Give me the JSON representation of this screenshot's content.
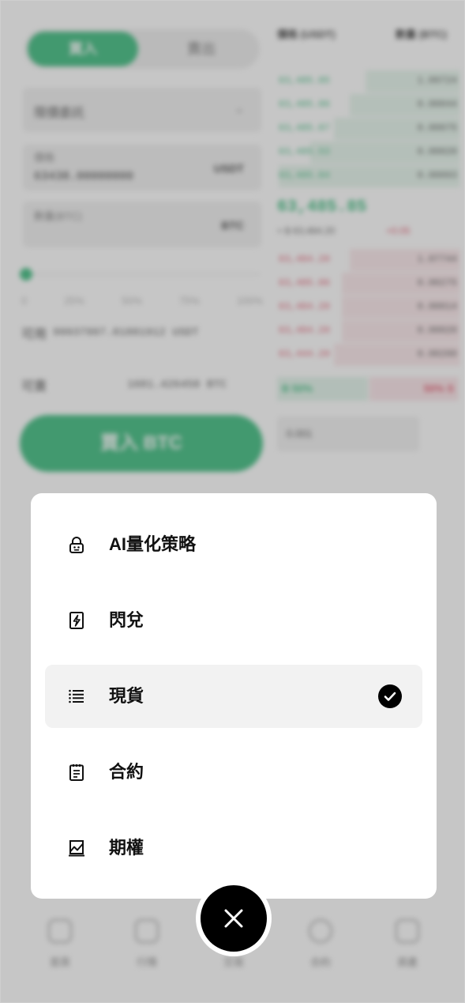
{
  "menu": {
    "items": [
      {
        "label": "AI量化策略",
        "icon": "robot-lock-icon",
        "selected": false
      },
      {
        "label": "閃兌",
        "icon": "flash-icon",
        "selected": false
      },
      {
        "label": "現貨",
        "icon": "list-icon",
        "selected": true
      },
      {
        "label": "合約",
        "icon": "contract-icon",
        "selected": false
      },
      {
        "label": "期權",
        "icon": "chart-icon",
        "selected": false
      }
    ],
    "close_icon": "close-icon",
    "check_icon": "check-circle-icon"
  },
  "background": {
    "buy_tab": "買入",
    "sell_tab": "賣出",
    "order_type": "限價委託",
    "price_label": "價格",
    "price_value": "63438.00000000",
    "price_unit": "USDT",
    "amount_label": "數量(BTC)",
    "amount_unit": "BTC",
    "percents": [
      "0",
      "25%",
      "50%",
      "75%",
      "100%"
    ],
    "available_label": "可用",
    "available_usdt": "99937997.81881912 USDT",
    "available_label_2": "可賣",
    "available_btc": "1681.426458 BTC",
    "buy_button": "買入 BTC",
    "book_head_price": "價格 (USDT)",
    "book_head_qty": "數量 (BTC)",
    "bids": [
      {
        "price": "63,485.85",
        "qty": "1.09724"
      },
      {
        "price": "63,485.86",
        "qty": "0.00044"
      },
      {
        "price": "63,485.87",
        "qty": "0.00075"
      },
      {
        "price": "63,485.53",
        "qty": "0.00020"
      },
      {
        "price": "63,485.84",
        "qty": "0.00093"
      }
    ],
    "mid_price": "63,485.85",
    "mid_sub": "≈ $ 63,484.20",
    "mid_change": "+0.05",
    "asks": [
      {
        "price": "63,484.20",
        "qty": "1.07744"
      },
      {
        "price": "63,485.86",
        "qty": "0.00275"
      },
      {
        "price": "63,484.20",
        "qty": "0.00014"
      },
      {
        "price": "63,484.20",
        "qty": "0.00020"
      },
      {
        "price": "63,444.20",
        "qty": "0.00200"
      }
    ],
    "ratio_buy": "B 50%",
    "ratio_sell": "50% S",
    "depth": "0.001",
    "tabs": [
      "首頁",
      "行情",
      "交易",
      "合約",
      "資產"
    ]
  }
}
